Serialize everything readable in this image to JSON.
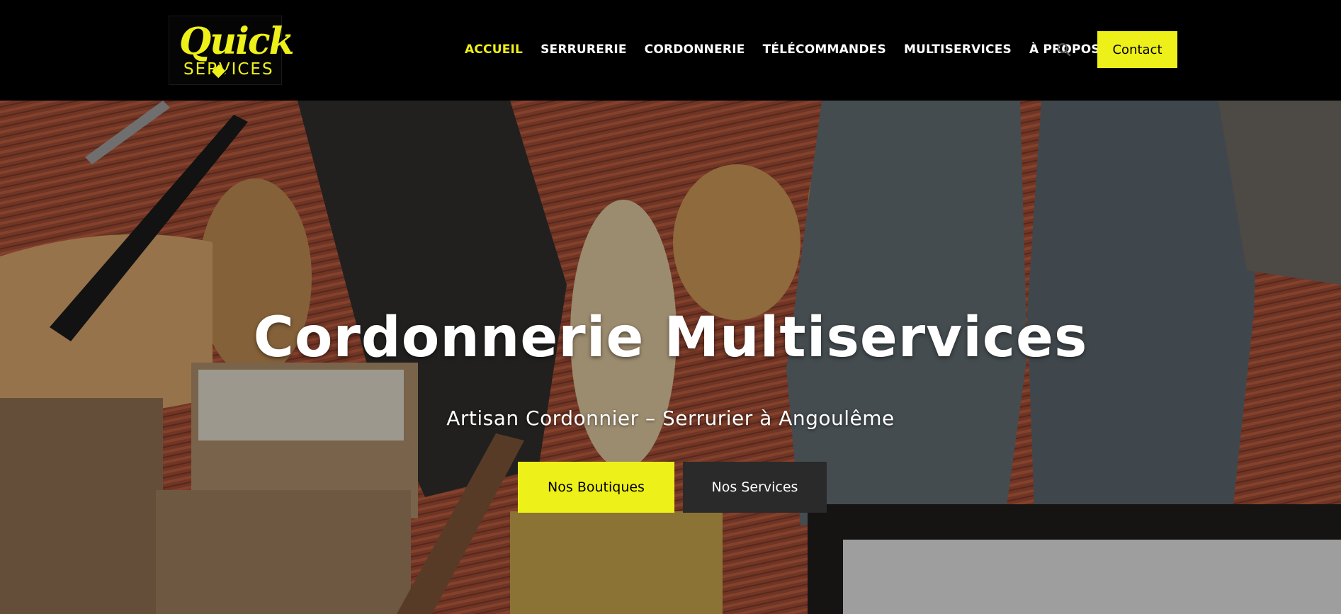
{
  "brand": {
    "logo_line1": "Quick",
    "logo_line2": "SERVICES",
    "accent_color": "#eef019"
  },
  "nav": {
    "items": [
      {
        "label": "ACCUEIL",
        "active": true
      },
      {
        "label": "SERRURERIE",
        "active": false
      },
      {
        "label": "CORDONNERIE",
        "active": false
      },
      {
        "label": "TÉLÉCOMMANDES",
        "active": false
      },
      {
        "label": "MULTISERVICES",
        "active": false
      },
      {
        "label": "À PROPOS",
        "active": false
      }
    ],
    "search_icon": "search-icon",
    "contact_label": "Contact"
  },
  "hero": {
    "title": "Cordonnerie Multiservices",
    "subtitle": "Artisan Cordonnier – Serrurier à Angoulême",
    "primary_button": "Nos Boutiques",
    "secondary_button": "Nos Services"
  }
}
